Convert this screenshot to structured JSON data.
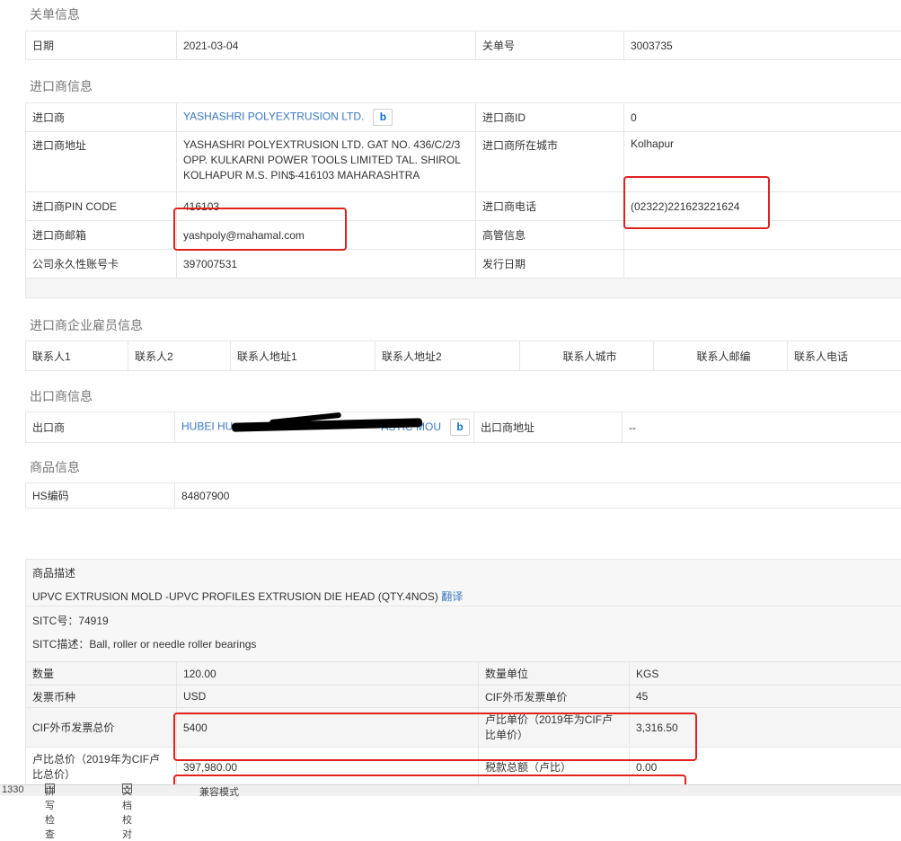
{
  "sections": {
    "customs": "关单信息",
    "importer": "进口商信息",
    "employees": "进口商企业雇员信息",
    "exporter": "出口商信息",
    "goods": "商品信息"
  },
  "customs": {
    "date_label": "日期",
    "date_value": "2021-03-04",
    "no_label": "关单号",
    "no_value": "3003735"
  },
  "importer": {
    "name_label": "进口商",
    "name_value": "YASHASHRI POLYEXTRUSION LTD.",
    "id_label": "进口商ID",
    "id_value": "0",
    "addr_label": "进口商地址",
    "addr_value": "YASHASHRI POLYEXTRUSION LTD. GAT NO. 436/C/2/3 OPP. KULKARNI POWER TOOLS LIMITED TAL. SHIROL KOLHAPUR M.S. PIN$-416103 MAHARASHTRA",
    "city_label": "进口商所在城市",
    "city_value": "Kolhapur",
    "pin_label": "进口商PIN CODE",
    "pin_value": "416103",
    "phone_label": "进口商电话",
    "phone_value": "(02322)221623221624",
    "email_label": "进口商邮箱",
    "email_value": "yashpoly@mahamal.com",
    "exec_label": "高管信息",
    "exec_value": "",
    "pan_label": "公司永久性账号卡",
    "pan_value": "397007531",
    "issue_label": "发行日期",
    "issue_value": ""
  },
  "employees": {
    "headers": [
      "联系人1",
      "联系人2",
      "联系人地址1",
      "联系人地址2",
      "联系人城市",
      "联系人邮编",
      "联系人电话"
    ]
  },
  "exporter": {
    "name_label": "出口商",
    "name_value": "HUBEI HU",
    "name_tail": "ASTIC MOU",
    "addr_label": "出口商地址",
    "addr_value": "--"
  },
  "goods": {
    "hs_label": "HS编码",
    "hs_value": "84807900",
    "desc_label": "商品描述",
    "desc_value": "UPVC EXTRUSION MOLD -UPVC PROFILES EXTRUSION DIE HEAD (QTY.4NOS)",
    "translate": "翻译",
    "sitc_no": "SITC号：74919",
    "sitc_desc": "SITC描述：Ball, roller or needle roller bearings"
  },
  "values": {
    "qty_label": "数量",
    "qty_value": "120.00",
    "unit_label": "数量单位",
    "unit_value": "KGS",
    "currency_label": "发票币种",
    "currency_value": "USD",
    "cif_unit_label": "CIF外币发票单价",
    "cif_unit_value": "45",
    "cif_total_label": "CIF外币发票总价",
    "cif_total_value": "5400",
    "inr_unit_label": "卢比单价（2019年为CIF卢比单价）",
    "inr_unit_value": "3,316.50",
    "inr_total_label": "卢比总价（2019年为CIF卢比总价）",
    "inr_total_value": "397,980.00",
    "tax_label": "税款总额（卢比）",
    "tax_value": "0.00"
  },
  "statusbar": {
    "count": "1330",
    "spell": "拼写检查",
    "proof": "文档校对",
    "compat": "兼容模式"
  }
}
